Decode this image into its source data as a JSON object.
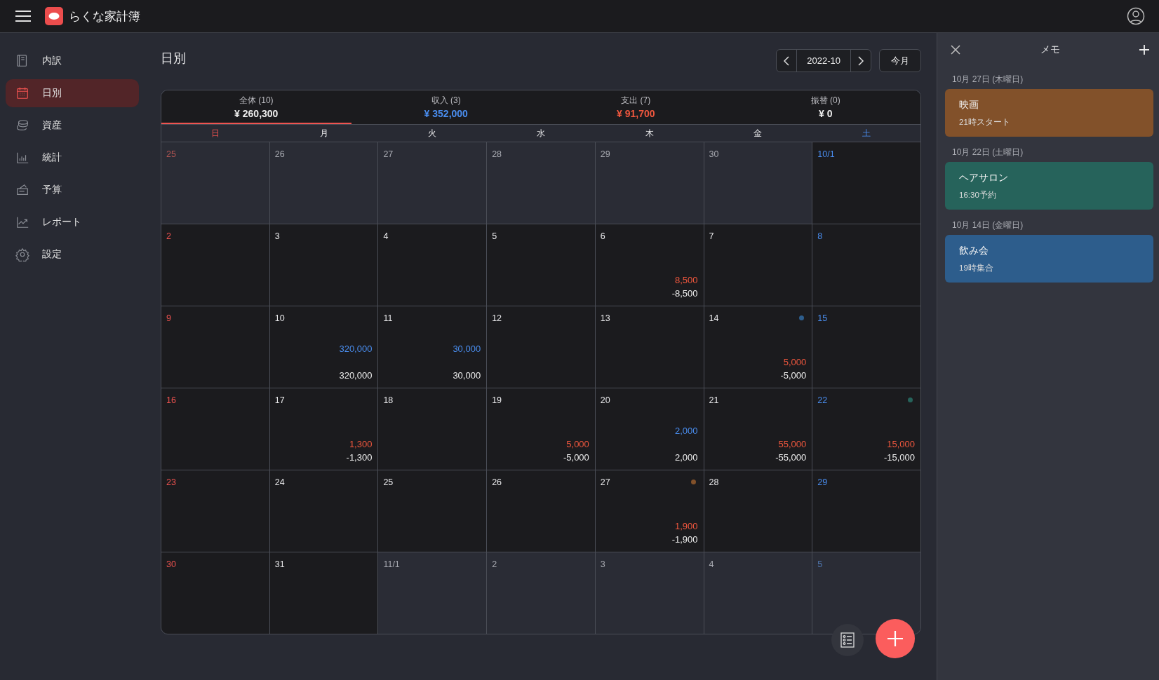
{
  "app": {
    "title": "らくな家計簿"
  },
  "sidebar": {
    "items": [
      {
        "label": "内訳",
        "selected": false
      },
      {
        "label": "日別",
        "selected": true
      },
      {
        "label": "資産",
        "selected": false
      },
      {
        "label": "統計",
        "selected": false
      },
      {
        "label": "予算",
        "selected": false
      },
      {
        "label": "レポート",
        "selected": false
      },
      {
        "label": "設定",
        "selected": false
      }
    ]
  },
  "page": {
    "title": "日別",
    "month": "2022-10",
    "today_button": "今月"
  },
  "summary_tabs": [
    {
      "label": "全体 (10)",
      "value": "¥ 260,300",
      "kind": "total",
      "selected": true
    },
    {
      "label": "収入 (3)",
      "value": "¥ 352,000",
      "kind": "income",
      "selected": false
    },
    {
      "label": "支出 (7)",
      "value": "¥ 91,700",
      "kind": "expense",
      "selected": false
    },
    {
      "label": "振替 (0)",
      "value": "¥ 0",
      "kind": "transfer",
      "selected": false
    }
  ],
  "weekdays": [
    "日",
    "月",
    "火",
    "水",
    "木",
    "金",
    "土"
  ],
  "days": [
    {
      "date": "25",
      "other_month": true
    },
    {
      "date": "26",
      "other_month": true
    },
    {
      "date": "27",
      "other_month": true
    },
    {
      "date": "28",
      "other_month": true
    },
    {
      "date": "29",
      "other_month": true
    },
    {
      "date": "30",
      "other_month": true
    },
    {
      "date": "10/1",
      "other_month": false
    },
    {
      "date": "2",
      "other_month": false
    },
    {
      "date": "3",
      "other_month": false
    },
    {
      "date": "4",
      "other_month": false
    },
    {
      "date": "5",
      "other_month": false
    },
    {
      "date": "6",
      "other_month": false,
      "expense": "8,500",
      "total": "-8,500"
    },
    {
      "date": "7",
      "other_month": false
    },
    {
      "date": "8",
      "other_month": false
    },
    {
      "date": "9",
      "other_month": false
    },
    {
      "date": "10",
      "other_month": false,
      "income": "320,000",
      "total": "320,000"
    },
    {
      "date": "11",
      "other_month": false,
      "income": "30,000",
      "total": "30,000"
    },
    {
      "date": "12",
      "other_month": false
    },
    {
      "date": "13",
      "other_month": false
    },
    {
      "date": "14",
      "other_month": false,
      "expense": "5,000",
      "total": "-5,000",
      "color": "#2d5d8c"
    },
    {
      "date": "15",
      "other_month": false
    },
    {
      "date": "16",
      "other_month": false
    },
    {
      "date": "17",
      "other_month": false,
      "expense": "1,300",
      "total": "-1,300"
    },
    {
      "date": "18",
      "other_month": false
    },
    {
      "date": "19",
      "other_month": false,
      "expense": "5,000",
      "total": "-5,000"
    },
    {
      "date": "20",
      "other_month": false,
      "income": "2,000",
      "total": "2,000"
    },
    {
      "date": "21",
      "other_month": false,
      "expense": "55,000",
      "total": "-55,000"
    },
    {
      "date": "22",
      "other_month": false,
      "expense": "15,000",
      "total": "-15,000",
      "color": "#26635b"
    },
    {
      "date": "23",
      "other_month": false
    },
    {
      "date": "24",
      "other_month": false
    },
    {
      "date": "25",
      "other_month": false
    },
    {
      "date": "26",
      "other_month": false
    },
    {
      "date": "27",
      "other_month": false,
      "expense": "1,900",
      "total": "-1,900",
      "color": "#82512a"
    },
    {
      "date": "28",
      "other_month": false
    },
    {
      "date": "29",
      "other_month": false
    },
    {
      "date": "30",
      "other_month": false
    },
    {
      "date": "31",
      "other_month": false
    },
    {
      "date": "11/1",
      "other_month": true
    },
    {
      "date": "2",
      "other_month": true
    },
    {
      "date": "3",
      "other_month": true
    },
    {
      "date": "4",
      "other_month": true
    },
    {
      "date": "5",
      "other_month": true
    }
  ],
  "memo_panel": {
    "title": "メモ",
    "memos": [
      {
        "date": "10月 27日 (木曜日)",
        "title": "映画",
        "body": "21時スタート",
        "color": "#82512a"
      },
      {
        "date": "10月 22日 (土曜日)",
        "title": "ヘアサロン",
        "body": "16:30予約",
        "color": "#26635b"
      },
      {
        "date": "10月 14日 (金曜日)",
        "title": "飲み会",
        "body": "19時集合",
        "color": "#2d5d8c"
      }
    ]
  }
}
